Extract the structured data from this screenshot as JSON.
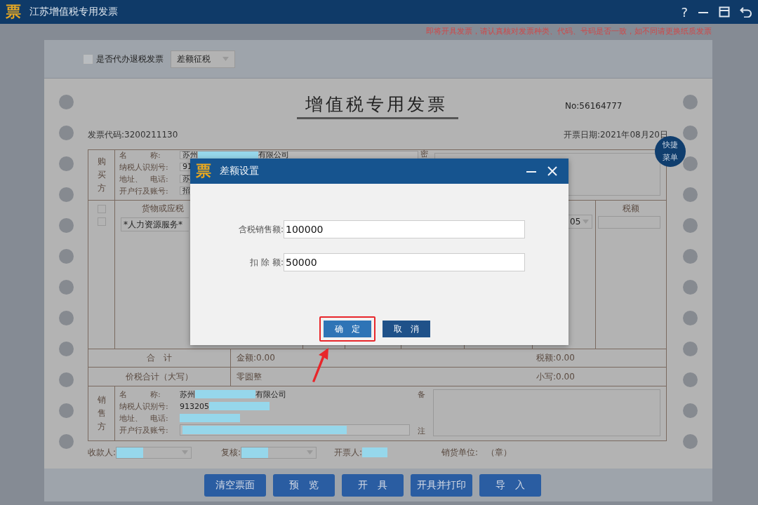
{
  "window": {
    "logo": "票",
    "title": "江苏增值税专用发票",
    "help": "?"
  },
  "notice": "即将开具发票，请认真核对发票种类、代码、号码是否一致，如不同请更换纸质发票",
  "toolbar": {
    "refund_checkbox": {
      "label": "是否代办退税发票",
      "checked": false
    },
    "tax_mode": {
      "value": "差额征税"
    }
  },
  "invoice": {
    "title": "增值税专用发票",
    "number": "No:56164777",
    "code": "发票代码:3200211130",
    "date": "开票日期:2021年08月20日",
    "buyer": {
      "side_label": "购买方",
      "password_label": "密",
      "rows": [
        {
          "label": "名　　　称:",
          "value": "苏州",
          "redacted": true,
          "value_end": "有限公司"
        },
        {
          "label": "纳税人识别号:",
          "value": "91"
        },
        {
          "label": "地址、　电话:",
          "value": "苏"
        },
        {
          "label": "开户行及账号:",
          "value": "招"
        }
      ]
    },
    "items": {
      "goods_header": "货物或应税",
      "tax_header": "税额",
      "line_checkboxes": [
        {
          "checked": false
        },
        {
          "checked": false
        }
      ],
      "rows": [
        {
          "goods": "*人力资源服务*",
          "rate": "05"
        }
      ]
    },
    "totals": {
      "label": "合　计",
      "amount": "金额:0.00",
      "tax": "税额:0.00"
    },
    "grand_total": {
      "label": "价税合计（大写）",
      "words": "零圆整",
      "figures": "小写:0.00"
    },
    "seller": {
      "side_label": "销售方",
      "remark_top": "备",
      "remark_bottom": "注",
      "rows": [
        {
          "label": "名　　　称:",
          "value": "苏州",
          "redacted": true,
          "value_end": "有限公司"
        },
        {
          "label": "纳税人识别号:",
          "value": "913205",
          "redacted": true
        },
        {
          "label": "地址、　电话:",
          "value": "",
          "redacted": true
        },
        {
          "label": "开户行及账号:",
          "value": "",
          "redacted": true
        }
      ]
    },
    "signers": [
      {
        "label": "收款人:",
        "redacted": true,
        "dropdown": true
      },
      {
        "label": "复核:",
        "redacted": true,
        "dropdown": true
      },
      {
        "label": "开票人:",
        "redacted": true,
        "dropdown": false
      },
      {
        "label": "销货单位:　（章）",
        "redacted": false,
        "dropdown": false
      }
    ]
  },
  "quick_menu": "快捷菜单",
  "actions": [
    "清空票面",
    "预　览",
    "开　具",
    "开具并打印",
    "导　入"
  ],
  "dialog": {
    "logo": "票",
    "title": "差额设置",
    "fields": [
      {
        "label": "含税销售额:",
        "value": "100000"
      },
      {
        "label": "扣 除 额:",
        "value": "50000"
      }
    ],
    "buttons": [
      {
        "label": "确　定",
        "kind": "primary",
        "highlighted": true
      },
      {
        "label": "取　消",
        "kind": "secondary",
        "highlighted": false
      }
    ]
  }
}
